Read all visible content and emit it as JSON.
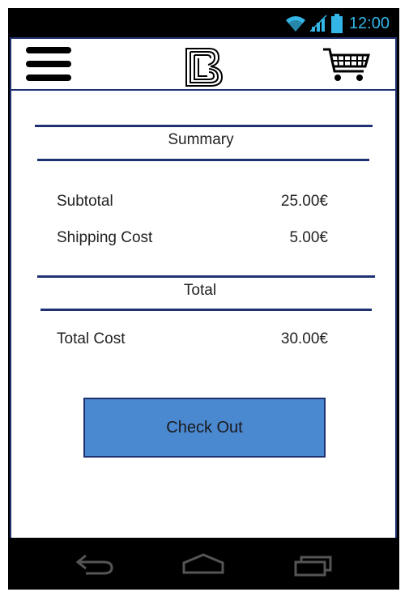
{
  "status_bar": {
    "time": "12:00"
  },
  "app_bar": {
    "menu_icon": "hamburger-menu-icon",
    "logo_icon": "brand-logo-b-icon",
    "cart_icon": "shopping-cart-icon"
  },
  "summary": {
    "title": "Summary",
    "rows": [
      {
        "label": "Subtotal",
        "value": "25.00€"
      },
      {
        "label": "Shipping Cost",
        "value": "5.00€"
      }
    ]
  },
  "total": {
    "title": "Total",
    "rows": [
      {
        "label": "Total Cost",
        "value": "30.00€"
      }
    ]
  },
  "checkout": {
    "label": "Check Out"
  },
  "colors": {
    "accent": "#4a88d0",
    "border": "#1f3170",
    "status_text": "#33b5e5"
  },
  "nav_bar": {
    "back_icon": "back-icon",
    "home_icon": "home-icon",
    "recent_icon": "recent-apps-icon"
  }
}
